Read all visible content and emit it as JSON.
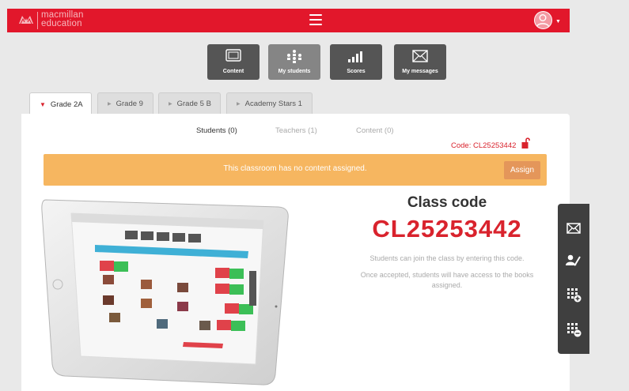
{
  "header": {
    "logo_line1": "macmillan",
    "logo_line2": "education",
    "brand_color": "#e2172b"
  },
  "toolbar": [
    {
      "label": "Content",
      "icon": "tablet-icon"
    },
    {
      "label": "My students",
      "icon": "students-icon"
    },
    {
      "label": "Scores",
      "icon": "bar-chart-icon"
    },
    {
      "label": "My messages",
      "icon": "envelope-icon"
    }
  ],
  "class_tabs": [
    {
      "label": "Grade 2A",
      "active": true
    },
    {
      "label": "Grade 9",
      "active": false
    },
    {
      "label": "Grade 5 B",
      "active": false
    },
    {
      "label": "Academy Stars 1",
      "active": false
    }
  ],
  "subtabs": {
    "students": "Students (0)",
    "teachers": "Teachers (1)",
    "content": "Content (0)"
  },
  "code_label": "Code: CL25253442",
  "banner": {
    "message": "This classroom has no content assigned.",
    "assign_label": "Assign",
    "color": "#f6b660"
  },
  "class_code": {
    "title": "Class code",
    "value": "CL25253442",
    "info1": "Students can join the class by entering this code.",
    "info2": "Once accepted, students will have access to the books assigned.",
    "accent": "#d9232d"
  },
  "sidebar_icons": [
    "envelope-icon",
    "user-edit-icon",
    "grid-add-icon",
    "grid-remove-icon"
  ]
}
